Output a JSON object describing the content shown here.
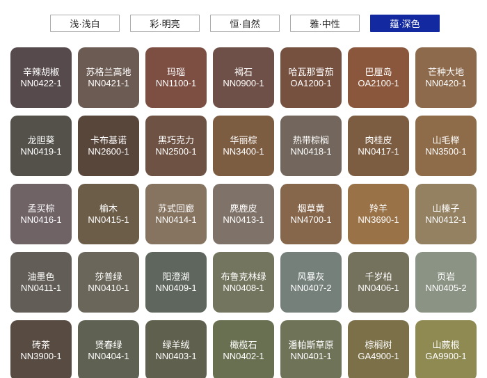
{
  "tabs": {
    "active_bg": "#12299F",
    "items": [
      {
        "label": "浅·浅白",
        "active": false
      },
      {
        "label": "彩·明亮",
        "active": false
      },
      {
        "label": "恒·自然",
        "active": false
      },
      {
        "label": "雅·中性",
        "active": false
      },
      {
        "label": "蕴·深色",
        "active": true
      }
    ]
  },
  "palette": {
    "swatches": [
      {
        "name": "辛辣胡椒",
        "code": "NN0422-1",
        "color": "#564A4C"
      },
      {
        "name": "苏格兰高地",
        "code": "NN0421-1",
        "color": "#6C5B53"
      },
      {
        "name": "玛瑙",
        "code": "NN1100-1",
        "color": "#7D4E42"
      },
      {
        "name": "褐石",
        "code": "NN0900-1",
        "color": "#6F5048"
      },
      {
        "name": "哈瓦那雪茄",
        "code": "OA1200-1",
        "color": "#765140"
      },
      {
        "name": "巴厘岛",
        "code": "OA2100-1",
        "color": "#8A573C"
      },
      {
        "name": "芒种大地",
        "code": "NN0420-1",
        "color": "#8C6A4B"
      },
      {
        "name": "龙胆葵",
        "code": "NN0419-1",
        "color": "#53514A"
      },
      {
        "name": "卡布基诺",
        "code": "NN2600-1",
        "color": "#59463B"
      },
      {
        "name": "黑巧克力",
        "code": "NN2500-1",
        "color": "#6E5243"
      },
      {
        "name": "华丽棕",
        "code": "NN3400-1",
        "color": "#7D5D42"
      },
      {
        "name": "热带棕榈",
        "code": "NN0418-1",
        "color": "#73675D"
      },
      {
        "name": "肉桂皮",
        "code": "NN0417-1",
        "color": "#7C5D41"
      },
      {
        "name": "山毛榉",
        "code": "NN3500-1",
        "color": "#8F6C49"
      },
      {
        "name": "孟买棕",
        "code": "NN0416-1",
        "color": "#6F6366"
      },
      {
        "name": "榆木",
        "code": "NN0415-1",
        "color": "#6C5D48"
      },
      {
        "name": "苏式回廊",
        "code": "NN0414-1",
        "color": "#877460"
      },
      {
        "name": "麂鹿皮",
        "code": "NN0413-1",
        "color": "#7F7268"
      },
      {
        "name": "烟草黄",
        "code": "NN4700-1",
        "color": "#86674B"
      },
      {
        "name": "羚羊",
        "code": "NN3690-1",
        "color": "#9A7248"
      },
      {
        "name": "山榛子",
        "code": "NN0412-1",
        "color": "#948162"
      },
      {
        "name": "油墨色",
        "code": "NN0411-1",
        "color": "#625D56"
      },
      {
        "name": "莎普绿",
        "code": "NN0410-1",
        "color": "#6A665A"
      },
      {
        "name": "阳澄湖",
        "code": "NN0409-1",
        "color": "#5E665D"
      },
      {
        "name": "布鲁克林绿",
        "code": "NN0408-1",
        "color": "#74755F"
      },
      {
        "name": "风暴灰",
        "code": "NN0407-2",
        "color": "#75807B"
      },
      {
        "name": "千岁柏",
        "code": "NN0406-1",
        "color": "#74715D"
      },
      {
        "name": "页岩",
        "code": "NN0405-2",
        "color": "#8B9384"
      },
      {
        "name": "砖茶",
        "code": "NN3900-1",
        "color": "#584C42"
      },
      {
        "name": "贤春绿",
        "code": "NN0404-1",
        "color": "#5F6253"
      },
      {
        "name": "绿羊绒",
        "code": "NN0403-1",
        "color": "#60604F"
      },
      {
        "name": "橄榄石",
        "code": "NN0402-1",
        "color": "#687051"
      },
      {
        "name": "潘帕斯草原",
        "code": "NN0401-1",
        "color": "#6F7358"
      },
      {
        "name": "棕榈树",
        "code": "GA4900-1",
        "color": "#7B7048"
      },
      {
        "name": "山蕨根",
        "code": "GA9900-1",
        "color": "#8E8A52"
      }
    ]
  }
}
